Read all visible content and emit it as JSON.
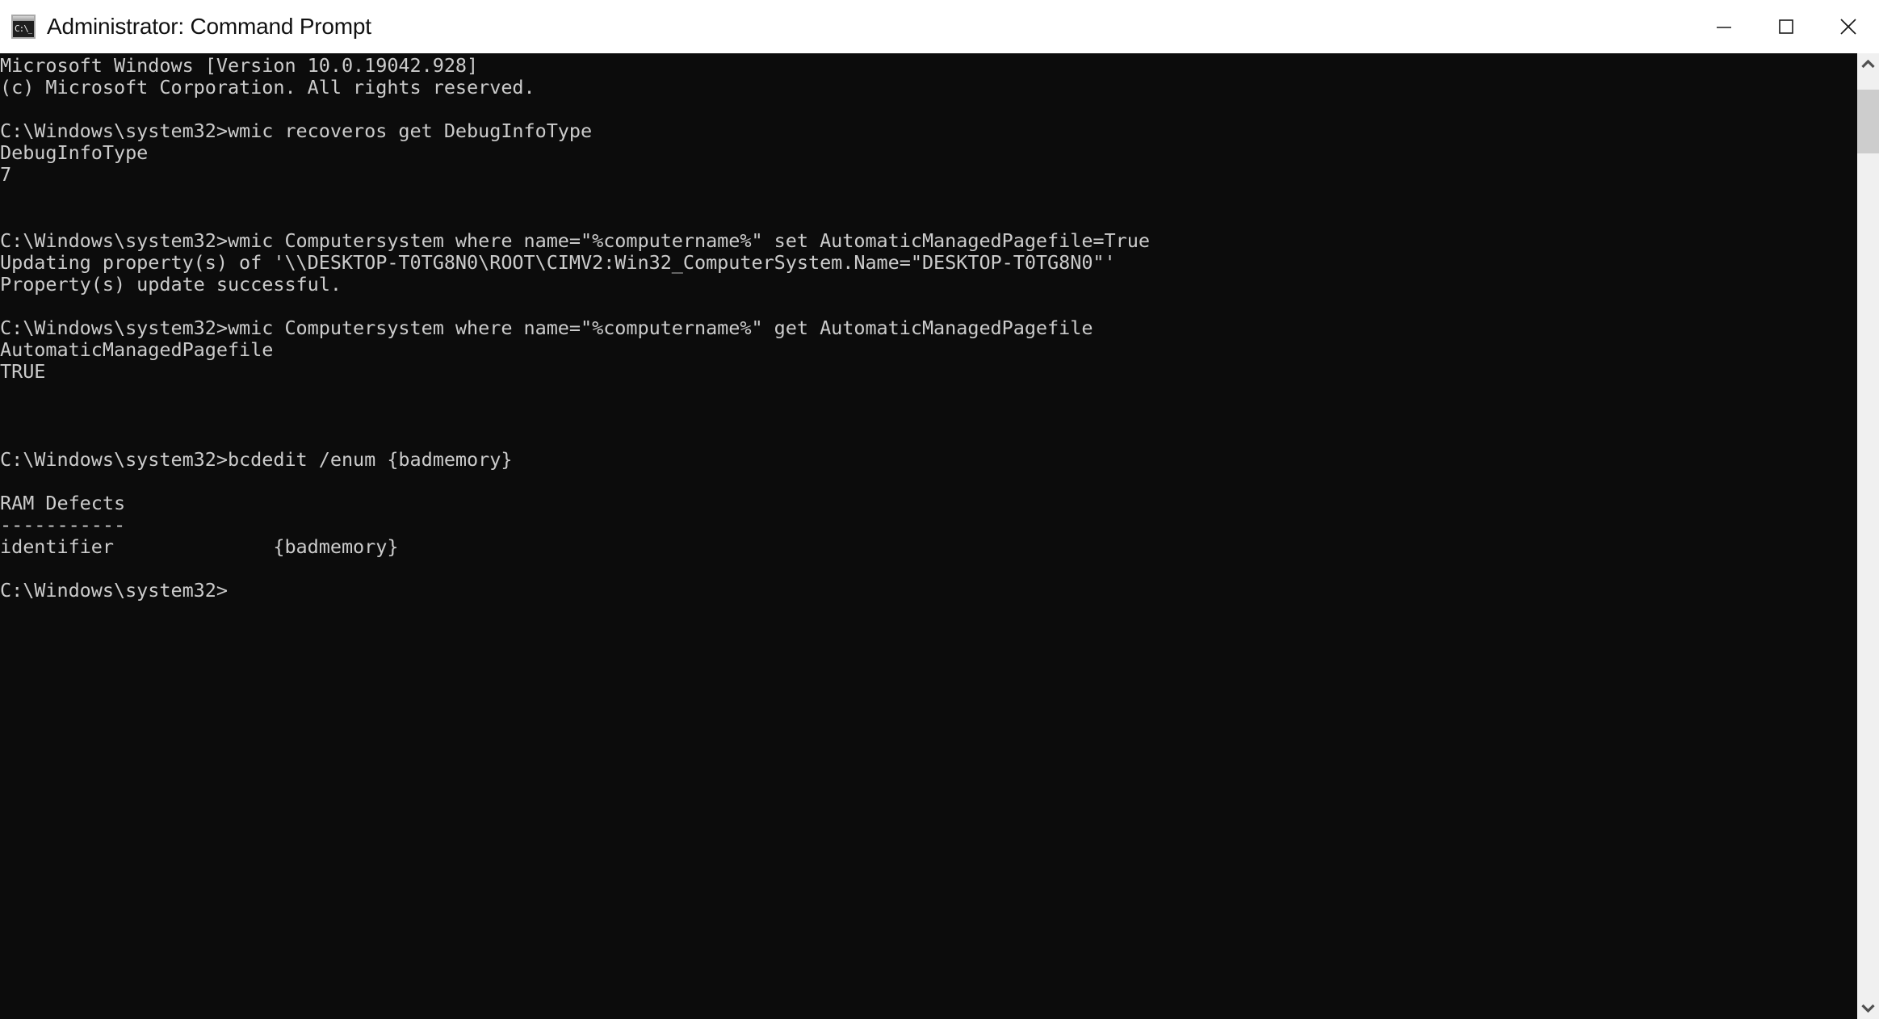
{
  "window": {
    "title": "Administrator: Command Prompt",
    "icon_name": "cmd-icon",
    "icon_glyph": "C:\\_",
    "controls": {
      "minimize_label": "Minimize",
      "maximize_label": "Maximize",
      "close_label": "Close"
    },
    "colors": {
      "titlebar_bg": "#ffffff",
      "console_bg": "#0c0c0c",
      "console_fg": "#cccccc",
      "scrollbar_track": "#f0f0f0",
      "scrollbar_thumb": "#cdcdcd"
    }
  },
  "scrollbar": {
    "up_arrow": "scroll-up-arrow",
    "down_arrow": "scroll-down-arrow",
    "thumb": "scrollbar-thumb"
  },
  "console": {
    "lines": [
      "Microsoft Windows [Version 10.0.19042.928]",
      "(c) Microsoft Corporation. All rights reserved.",
      "",
      "C:\\Windows\\system32>wmic recoveros get DebugInfoType",
      "DebugInfoType",
      "7",
      "",
      "",
      "C:\\Windows\\system32>wmic Computersystem where name=\"%computername%\" set AutomaticManagedPagefile=True",
      "Updating property(s) of '\\\\DESKTOP-T0TG8N0\\ROOT\\CIMV2:Win32_ComputerSystem.Name=\"DESKTOP-T0TG8N0\"'",
      "Property(s) update successful.",
      "",
      "C:\\Windows\\system32>wmic Computersystem where name=\"%computername%\" get AutomaticManagedPagefile",
      "AutomaticManagedPagefile",
      "TRUE",
      "",
      "",
      "",
      "C:\\Windows\\system32>bcdedit /enum {badmemory}",
      "",
      "RAM Defects",
      "-----------",
      "identifier              {badmemory}",
      "",
      "C:\\Windows\\system32>"
    ]
  }
}
